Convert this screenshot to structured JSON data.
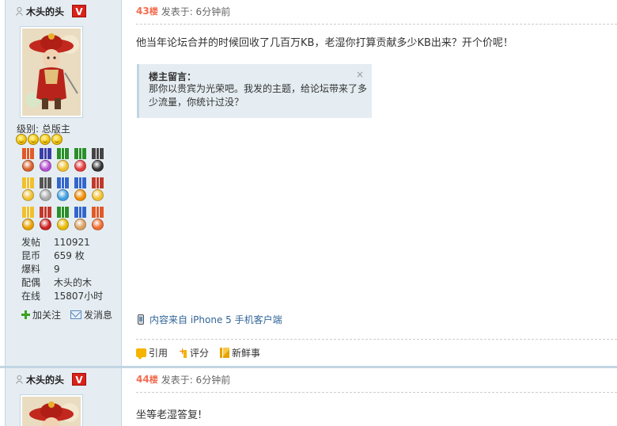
{
  "posts": [
    {
      "user": {
        "name": "木头的头",
        "badge": "V",
        "rank": "级别: 总版主",
        "stats": [
          {
            "key": "发帖",
            "value": "110921"
          },
          {
            "key": "昆币",
            "value": "659 枚"
          },
          {
            "key": "爆料",
            "value": "9"
          },
          {
            "key": "配偶",
            "value": "木头的木"
          },
          {
            "key": "在线",
            "value": "15807小时"
          }
        ],
        "follow_label": "加关注",
        "message_label": "发消息"
      },
      "floor": "43",
      "floor_suffix": "楼",
      "time": "发表于: 6分钟前",
      "message": "他当年论坛合并的时候回收了几百万KB，老湿你打算贡献多少KB出来？开个价呢！",
      "comment": {
        "title": "楼主留言：",
        "body": "那你以贵宾为光荣吧。我发的主题，给论坛带来了多少流量，你统计过没？",
        "close": "×"
      },
      "source": "内容来自 iPhone 5 手机客户端",
      "actions": {
        "quote": "引用",
        "rate": "评分",
        "news": "新鲜事"
      }
    },
    {
      "user": {
        "name": "木头的头",
        "badge": "V"
      },
      "floor": "44",
      "floor_suffix": "楼",
      "time": "发表于: 6分钟前",
      "message": "坐等老湿答复!"
    }
  ],
  "colors": {
    "sidebar_bg": "#e5edf2",
    "border": "#c2d5e3",
    "floor": "#f26c4f",
    "link": "#336699",
    "vip_badge": "#d8231a"
  },
  "medals": [
    {
      "ribbon": "#e05a2a",
      "disc": "#d9602b"
    },
    {
      "ribbon": "#3b3fa8",
      "disc": "#b64fd1"
    },
    {
      "ribbon": "#2a8f2a",
      "disc": "#f0c030"
    },
    {
      "ribbon": "#2a8f2a",
      "disc": "#e23a3a"
    },
    {
      "ribbon": "#444444",
      "disc": "#333333"
    },
    {
      "ribbon": "#f0c030",
      "disc": "#f0c030"
    },
    {
      "ribbon": "#555555",
      "disc": "#aaaaaa"
    },
    {
      "ribbon": "#3366cc",
      "disc": "#3f9fe0"
    },
    {
      "ribbon": "#3366cc",
      "disc": "#f08c00"
    },
    {
      "ribbon": "#c0392b",
      "disc": "#f0c030"
    },
    {
      "ribbon": "#f0c030",
      "disc": "#e8a000"
    },
    {
      "ribbon": "#c0392b",
      "disc": "#cc2222"
    },
    {
      "ribbon": "#2a8f2a",
      "disc": "#e6b800"
    },
    {
      "ribbon": "#3366cc",
      "disc": "#d9a060"
    },
    {
      "ribbon": "#e05a2a",
      "disc": "#ee6a30"
    }
  ]
}
